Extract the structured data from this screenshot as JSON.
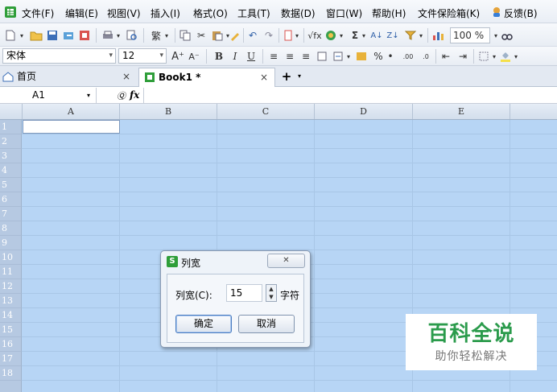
{
  "menubar": {
    "items": [
      "文件(F)",
      "编辑(E)",
      "视图(V)",
      "插入(I)",
      "格式(O)",
      "工具(T)",
      "数据(D)",
      "窗口(W)",
      "帮助(H)",
      "文件保险箱(K)",
      "反馈(B)"
    ]
  },
  "toolbar": {
    "zoom": "100 %",
    "font_name": "宋体",
    "font_size": "12",
    "bold": "B",
    "italic": "I",
    "underline": "U",
    "percent": "%",
    "sum": "Σ",
    "fx_label": "√fx"
  },
  "tabs": {
    "home": "首页",
    "book": "Book1 *",
    "close": "×",
    "new": "+"
  },
  "formula": {
    "cell_ref": "A1",
    "fx": "fx"
  },
  "grid": {
    "columns": [
      "A",
      "B",
      "C",
      "D",
      "E"
    ],
    "rows": [
      "1",
      "2",
      "3",
      "4",
      "5",
      "6",
      "7",
      "8",
      "9",
      "10",
      "11",
      "12",
      "13",
      "14",
      "15",
      "16",
      "17",
      "18"
    ]
  },
  "dialog": {
    "title": "列宽",
    "icon_letter": "S",
    "label": "列宽(C):",
    "value": "15",
    "unit": "字符",
    "ok": "确定",
    "cancel": "取消",
    "close_glyph": "✕"
  },
  "watermark": {
    "title": "百科全说",
    "subtitle": "助你轻松解决"
  }
}
